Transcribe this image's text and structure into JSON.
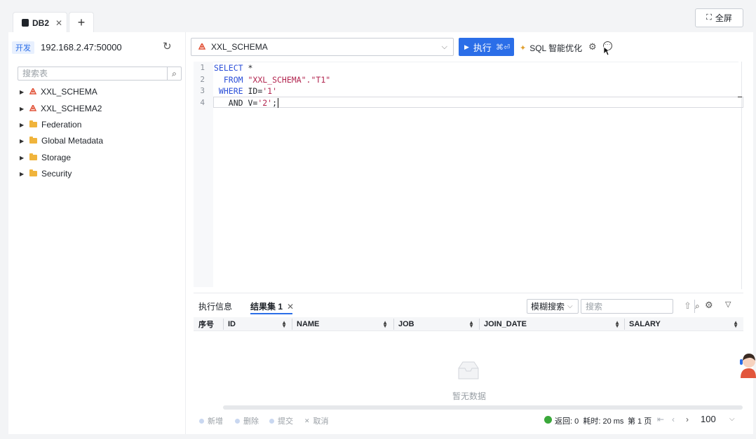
{
  "tabs": [
    {
      "label": "DB2"
    }
  ],
  "top_bar": {
    "fullscreen_label": "全屏"
  },
  "connection": {
    "env_badge": "开发",
    "host": "192.168.2.47:50000"
  },
  "tree": {
    "search_placeholder": "搜索表",
    "items": [
      {
        "label": "XXL_SCHEMA",
        "type": "schema"
      },
      {
        "label": "XXL_SCHEMA2",
        "type": "schema"
      },
      {
        "label": "Federation",
        "type": "folder"
      },
      {
        "label": "Global Metadata",
        "type": "folder"
      },
      {
        "label": "Storage",
        "type": "folder"
      },
      {
        "label": "Security",
        "type": "folder"
      }
    ]
  },
  "toolbar": {
    "schema_selected": "XXL_SCHEMA",
    "run_label": "执行",
    "run_shortcut": "⌘⏎",
    "ai_optimize_label": "SQL 智能优化"
  },
  "editor": {
    "line_numbers": [
      "1",
      "2",
      "3",
      "4"
    ],
    "lines": [
      [
        {
          "t": "SELECT",
          "c": "kw"
        },
        {
          "t": " *",
          "c": "plain"
        }
      ],
      [
        {
          "t": "  FROM ",
          "c": "kw"
        },
        {
          "t": "\"XXL_SCHEMA\".\"T1\"",
          "c": "str"
        }
      ],
      [
        {
          "t": " WHERE ",
          "c": "kw"
        },
        {
          "t": "ID=",
          "c": "plain"
        },
        {
          "t": "'1'",
          "c": "str"
        }
      ],
      [
        {
          "t": "   AND ",
          "c": "plain"
        },
        {
          "t": "V=",
          "c": "plain"
        },
        {
          "t": "'2'",
          "c": "str"
        },
        {
          "t": ";",
          "c": "plain"
        }
      ]
    ]
  },
  "results": {
    "tab_exec_info": "执行信息",
    "tab_resultset": "结果集 1",
    "fuzzy_search_label": "模糊搜索",
    "search_placeholder": "搜索",
    "columns": [
      "序号",
      "ID",
      "NAME",
      "JOB",
      "JOIN_DATE",
      "SALARY"
    ],
    "empty_text": "暂无数据"
  },
  "footer": {
    "actions": [
      "新增",
      "删除",
      "提交",
      "取消"
    ],
    "status": "返回: 0  耗时: 20 ms",
    "page": "第 1 页",
    "page_size": "100"
  },
  "colors": {
    "accent": "#2b6ee8",
    "success": "#3aa83a",
    "folder": "#f0b43c",
    "schema_icon": "#e2553b"
  }
}
